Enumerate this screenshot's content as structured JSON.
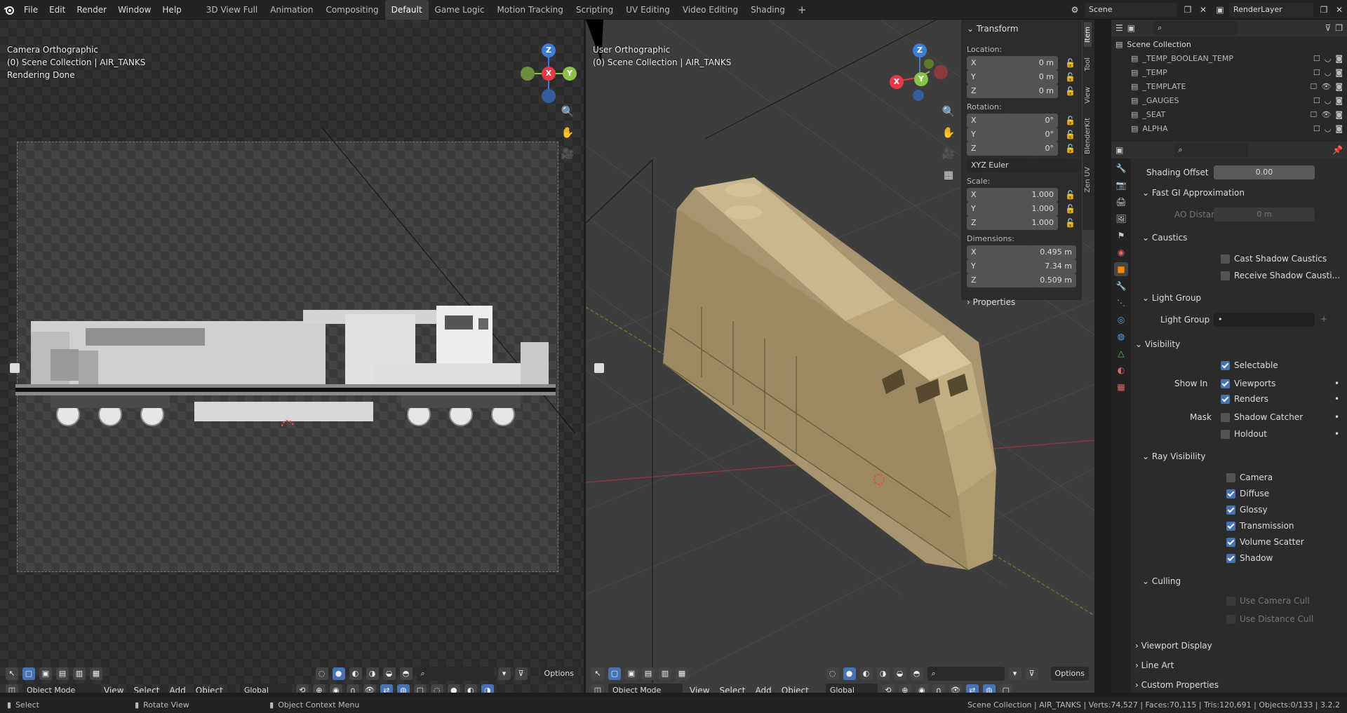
{
  "app": {
    "menus": [
      "File",
      "Edit",
      "Render",
      "Window",
      "Help"
    ],
    "workspaces": [
      "3D View Full",
      "Animation",
      "Compositing",
      "Default",
      "Game Logic",
      "Motion Tracking",
      "Scripting",
      "UV Editing",
      "Video Editing",
      "Shading"
    ],
    "active_workspace": "Default",
    "add_tab": "+",
    "scene_label": "Scene",
    "layer_label": "RenderLayer"
  },
  "left_viewport": {
    "title": "Camera Orthographic",
    "collection": "(0) Scene Collection | AIR_TANKS",
    "status": "Rendering Done",
    "mode": "Object Mode",
    "menus": [
      "View",
      "Select",
      "Add",
      "Object"
    ],
    "transform": "Global",
    "options": "Options"
  },
  "right_viewport": {
    "title": "User Orthographic",
    "collection": "(0) Scene Collection | AIR_TANKS",
    "mode": "Object Mode",
    "menus": [
      "View",
      "Select",
      "Add",
      "Object"
    ],
    "transform": "Global",
    "options": "Options"
  },
  "gizmo": {
    "x": "X",
    "y": "Y",
    "z": "Z"
  },
  "npanel": {
    "tabs": [
      "Item",
      "Tool",
      "View",
      "BlenderKit",
      "Zen UV"
    ],
    "header": "Transform",
    "location_label": "Location:",
    "location": {
      "x": "0 m",
      "y": "0 m",
      "z": "0 m"
    },
    "rotation_label": "Rotation:",
    "rotation": {
      "x": "0°",
      "y": "0°",
      "z": "0°"
    },
    "rotation_mode": "XYZ Euler",
    "scale_label": "Scale:",
    "scale": {
      "x": "1.000",
      "y": "1.000",
      "z": "1.000"
    },
    "dimensions_label": "Dimensions:",
    "dimensions": {
      "x": "0.495 m",
      "y": "7.34 m",
      "z": "0.509 m"
    },
    "properties": "Properties"
  },
  "outliner": {
    "root": "Scene Collection",
    "items": [
      "_TEMP_BOOLEAN_TEMP",
      "_TEMP",
      "_TEMPLATE",
      "_GAUGES",
      "_SEAT",
      "ALPHA"
    ]
  },
  "properties": {
    "shading_offset_label": "Shading Offset",
    "shading_offset_value": "0.00",
    "fast_gi": "Fast GI Approximation",
    "ao_distance_label": "AO Distance",
    "ao_distance_value": "0 m",
    "caustics": "Caustics",
    "cast_shadow_caustics": "Cast Shadow Caustics",
    "receive_shadow_caustics": "Receive Shadow Causti...",
    "light_group_section": "Light Group",
    "light_group_label": "Light Group",
    "visibility": "Visibility",
    "selectable": "Selectable",
    "show_in_label": "Show In",
    "viewports": "Viewports",
    "renders": "Renders",
    "mask_label": "Mask",
    "shadow_catcher": "Shadow Catcher",
    "holdout": "Holdout",
    "ray_visibility": "Ray Visibility",
    "camera": "Camera",
    "diffuse": "Diffuse",
    "glossy": "Glossy",
    "transmission": "Transmission",
    "volume_scatter": "Volume Scatter",
    "shadow": "Shadow",
    "culling": "Culling",
    "use_camera_cull": "Use Camera Cull",
    "use_distance_cull": "Use Distance Cull",
    "viewport_display": "Viewport Display",
    "line_art": "Line Art",
    "custom_properties": "Custom Properties"
  },
  "statusbar": {
    "select": "Select",
    "rotate_view": "Rotate View",
    "context_menu": "Object Context Menu",
    "stats": "Scene Collection | AIR_TANKS | Verts:74,527 | Faces:70,115 | Tris:120,691 | Objects:0/133 | 3.2.2"
  },
  "colors": {
    "accent": "#4772b3",
    "x_axis": "#e63946",
    "y_axis": "#8bc34a",
    "z_axis": "#3d7fd6",
    "loco_tan": "#b8a57a"
  }
}
